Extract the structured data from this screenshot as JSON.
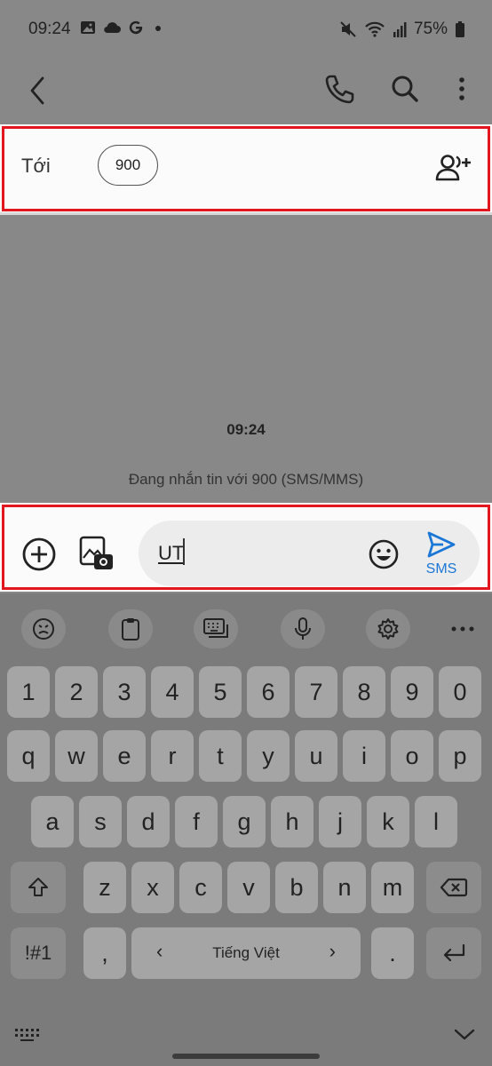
{
  "status_bar": {
    "time": "09:24",
    "left_icons": [
      "gallery-icon",
      "cloud-icon",
      "google-icon",
      "dot-icon"
    ],
    "battery": "75%",
    "right_icons": [
      "mute-icon",
      "wifi-icon",
      "signal-icon",
      "battery-icon"
    ]
  },
  "app_bar": {
    "icons": [
      "back-icon",
      "phone-icon",
      "search-icon",
      "more-vert-icon"
    ]
  },
  "recipient": {
    "to_label": "Tới",
    "chip_value": "900",
    "add_icon": "add-contact-icon"
  },
  "conversation": {
    "time": "09:24",
    "hint": "Đang nhắn tin với 900 (SMS/MMS)"
  },
  "compose": {
    "text": "UT",
    "send_label": "SMS",
    "accent_color": "#1b77d6"
  },
  "highlight_color": "#e3161f",
  "keyboard": {
    "toolbar_icons": [
      "emoji-face-icon",
      "clipboard-icon",
      "keyboard-icon",
      "mic-icon",
      "settings-icon",
      "more-horiz-icon"
    ],
    "row_numbers": [
      "1",
      "2",
      "3",
      "4",
      "5",
      "6",
      "7",
      "8",
      "9",
      "0"
    ],
    "row1": [
      "q",
      "w",
      "e",
      "r",
      "t",
      "y",
      "u",
      "i",
      "o",
      "p"
    ],
    "row2": [
      "a",
      "s",
      "d",
      "f",
      "g",
      "h",
      "j",
      "k",
      "l"
    ],
    "row3": [
      "z",
      "x",
      "c",
      "v",
      "b",
      "n",
      "m"
    ],
    "symbols_key": "!#1",
    "comma_key": ",",
    "space_label": "Tiếng Việt",
    "space_left": "‹",
    "space_right": "›",
    "period_key": ".",
    "bottom_icons": [
      "keyboard-grid-icon",
      "chevron-down-icon"
    ]
  }
}
